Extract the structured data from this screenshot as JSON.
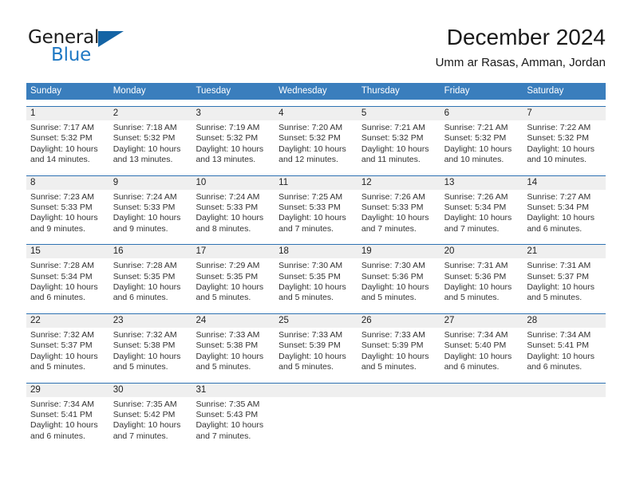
{
  "brand": {
    "word_one": "General",
    "word_two": "Blue",
    "icon": "triangle-logo-icon",
    "color_dark": "#1c1c1c",
    "color_blue": "#2079c4",
    "triangle_color": "#1464a5"
  },
  "header": {
    "title": "December 2024",
    "subtitle": "Umm ar Rasas, Amman, Jordan"
  },
  "theme": {
    "header_blue": "#3a7ebd",
    "week_divider_blue": "#2f72b3",
    "daynum_band": "#efefef",
    "text": "#333333"
  },
  "weekdays": [
    "Sunday",
    "Monday",
    "Tuesday",
    "Wednesday",
    "Thursday",
    "Friday",
    "Saturday"
  ],
  "weeks": [
    {
      "days": [
        {
          "num": "1",
          "sunrise": "Sunrise: 7:17 AM",
          "sunset": "Sunset: 5:32 PM",
          "daylight1": "Daylight: 10 hours",
          "daylight2": "and 14 minutes."
        },
        {
          "num": "2",
          "sunrise": "Sunrise: 7:18 AM",
          "sunset": "Sunset: 5:32 PM",
          "daylight1": "Daylight: 10 hours",
          "daylight2": "and 13 minutes."
        },
        {
          "num": "3",
          "sunrise": "Sunrise: 7:19 AM",
          "sunset": "Sunset: 5:32 PM",
          "daylight1": "Daylight: 10 hours",
          "daylight2": "and 13 minutes."
        },
        {
          "num": "4",
          "sunrise": "Sunrise: 7:20 AM",
          "sunset": "Sunset: 5:32 PM",
          "daylight1": "Daylight: 10 hours",
          "daylight2": "and 12 minutes."
        },
        {
          "num": "5",
          "sunrise": "Sunrise: 7:21 AM",
          "sunset": "Sunset: 5:32 PM",
          "daylight1": "Daylight: 10 hours",
          "daylight2": "and 11 minutes."
        },
        {
          "num": "6",
          "sunrise": "Sunrise: 7:21 AM",
          "sunset": "Sunset: 5:32 PM",
          "daylight1": "Daylight: 10 hours",
          "daylight2": "and 10 minutes."
        },
        {
          "num": "7",
          "sunrise": "Sunrise: 7:22 AM",
          "sunset": "Sunset: 5:32 PM",
          "daylight1": "Daylight: 10 hours",
          "daylight2": "and 10 minutes."
        }
      ]
    },
    {
      "days": [
        {
          "num": "8",
          "sunrise": "Sunrise: 7:23 AM",
          "sunset": "Sunset: 5:33 PM",
          "daylight1": "Daylight: 10 hours",
          "daylight2": "and 9 minutes."
        },
        {
          "num": "9",
          "sunrise": "Sunrise: 7:24 AM",
          "sunset": "Sunset: 5:33 PM",
          "daylight1": "Daylight: 10 hours",
          "daylight2": "and 9 minutes."
        },
        {
          "num": "10",
          "sunrise": "Sunrise: 7:24 AM",
          "sunset": "Sunset: 5:33 PM",
          "daylight1": "Daylight: 10 hours",
          "daylight2": "and 8 minutes."
        },
        {
          "num": "11",
          "sunrise": "Sunrise: 7:25 AM",
          "sunset": "Sunset: 5:33 PM",
          "daylight1": "Daylight: 10 hours",
          "daylight2": "and 7 minutes."
        },
        {
          "num": "12",
          "sunrise": "Sunrise: 7:26 AM",
          "sunset": "Sunset: 5:33 PM",
          "daylight1": "Daylight: 10 hours",
          "daylight2": "and 7 minutes."
        },
        {
          "num": "13",
          "sunrise": "Sunrise: 7:26 AM",
          "sunset": "Sunset: 5:34 PM",
          "daylight1": "Daylight: 10 hours",
          "daylight2": "and 7 minutes."
        },
        {
          "num": "14",
          "sunrise": "Sunrise: 7:27 AM",
          "sunset": "Sunset: 5:34 PM",
          "daylight1": "Daylight: 10 hours",
          "daylight2": "and 6 minutes."
        }
      ]
    },
    {
      "days": [
        {
          "num": "15",
          "sunrise": "Sunrise: 7:28 AM",
          "sunset": "Sunset: 5:34 PM",
          "daylight1": "Daylight: 10 hours",
          "daylight2": "and 6 minutes."
        },
        {
          "num": "16",
          "sunrise": "Sunrise: 7:28 AM",
          "sunset": "Sunset: 5:35 PM",
          "daylight1": "Daylight: 10 hours",
          "daylight2": "and 6 minutes."
        },
        {
          "num": "17",
          "sunrise": "Sunrise: 7:29 AM",
          "sunset": "Sunset: 5:35 PM",
          "daylight1": "Daylight: 10 hours",
          "daylight2": "and 5 minutes."
        },
        {
          "num": "18",
          "sunrise": "Sunrise: 7:30 AM",
          "sunset": "Sunset: 5:35 PM",
          "daylight1": "Daylight: 10 hours",
          "daylight2": "and 5 minutes."
        },
        {
          "num": "19",
          "sunrise": "Sunrise: 7:30 AM",
          "sunset": "Sunset: 5:36 PM",
          "daylight1": "Daylight: 10 hours",
          "daylight2": "and 5 minutes."
        },
        {
          "num": "20",
          "sunrise": "Sunrise: 7:31 AM",
          "sunset": "Sunset: 5:36 PM",
          "daylight1": "Daylight: 10 hours",
          "daylight2": "and 5 minutes."
        },
        {
          "num": "21",
          "sunrise": "Sunrise: 7:31 AM",
          "sunset": "Sunset: 5:37 PM",
          "daylight1": "Daylight: 10 hours",
          "daylight2": "and 5 minutes."
        }
      ]
    },
    {
      "days": [
        {
          "num": "22",
          "sunrise": "Sunrise: 7:32 AM",
          "sunset": "Sunset: 5:37 PM",
          "daylight1": "Daylight: 10 hours",
          "daylight2": "and 5 minutes."
        },
        {
          "num": "23",
          "sunrise": "Sunrise: 7:32 AM",
          "sunset": "Sunset: 5:38 PM",
          "daylight1": "Daylight: 10 hours",
          "daylight2": "and 5 minutes."
        },
        {
          "num": "24",
          "sunrise": "Sunrise: 7:33 AM",
          "sunset": "Sunset: 5:38 PM",
          "daylight1": "Daylight: 10 hours",
          "daylight2": "and 5 minutes."
        },
        {
          "num": "25",
          "sunrise": "Sunrise: 7:33 AM",
          "sunset": "Sunset: 5:39 PM",
          "daylight1": "Daylight: 10 hours",
          "daylight2": "and 5 minutes."
        },
        {
          "num": "26",
          "sunrise": "Sunrise: 7:33 AM",
          "sunset": "Sunset: 5:39 PM",
          "daylight1": "Daylight: 10 hours",
          "daylight2": "and 5 minutes."
        },
        {
          "num": "27",
          "sunrise": "Sunrise: 7:34 AM",
          "sunset": "Sunset: 5:40 PM",
          "daylight1": "Daylight: 10 hours",
          "daylight2": "and 6 minutes."
        },
        {
          "num": "28",
          "sunrise": "Sunrise: 7:34 AM",
          "sunset": "Sunset: 5:41 PM",
          "daylight1": "Daylight: 10 hours",
          "daylight2": "and 6 minutes."
        }
      ]
    },
    {
      "days": [
        {
          "num": "29",
          "sunrise": "Sunrise: 7:34 AM",
          "sunset": "Sunset: 5:41 PM",
          "daylight1": "Daylight: 10 hours",
          "daylight2": "and 6 minutes."
        },
        {
          "num": "30",
          "sunrise": "Sunrise: 7:35 AM",
          "sunset": "Sunset: 5:42 PM",
          "daylight1": "Daylight: 10 hours",
          "daylight2": "and 7 minutes."
        },
        {
          "num": "31",
          "sunrise": "Sunrise: 7:35 AM",
          "sunset": "Sunset: 5:43 PM",
          "daylight1": "Daylight: 10 hours",
          "daylight2": "and 7 minutes."
        },
        {
          "num": "",
          "sunrise": "",
          "sunset": "",
          "daylight1": "",
          "daylight2": ""
        },
        {
          "num": "",
          "sunrise": "",
          "sunset": "",
          "daylight1": "",
          "daylight2": ""
        },
        {
          "num": "",
          "sunrise": "",
          "sunset": "",
          "daylight1": "",
          "daylight2": ""
        },
        {
          "num": "",
          "sunrise": "",
          "sunset": "",
          "daylight1": "",
          "daylight2": ""
        }
      ]
    }
  ]
}
